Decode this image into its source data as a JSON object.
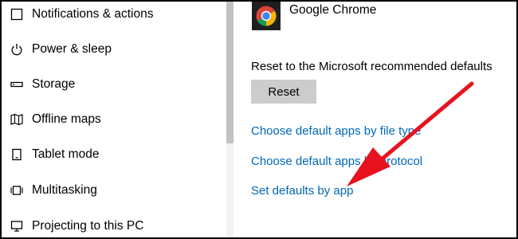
{
  "sidebar": {
    "items": [
      {
        "label": "Notifications & actions",
        "icon": "notifications-icon"
      },
      {
        "label": "Power & sleep",
        "icon": "power-icon"
      },
      {
        "label": "Storage",
        "icon": "storage-icon"
      },
      {
        "label": "Offline maps",
        "icon": "map-icon"
      },
      {
        "label": "Tablet mode",
        "icon": "tablet-icon"
      },
      {
        "label": "Multitasking",
        "icon": "multitasking-icon"
      },
      {
        "label": "Projecting to this PC",
        "icon": "projecting-icon"
      }
    ]
  },
  "main": {
    "default_app": {
      "name": "Google Chrome",
      "icon": "chrome-icon"
    },
    "reset": {
      "label": "Reset to the Microsoft recommended defaults",
      "button_label": "Reset"
    },
    "links": {
      "by_file_type": "Choose default apps by file type",
      "by_protocol": "Choose default apps by protocol",
      "by_app": "Set defaults by app"
    }
  },
  "annotation": {
    "arrow_color": "#e8121f"
  },
  "colors": {
    "link": "#0067b8",
    "button": "#cccccc",
    "scrollbar_thumb": "#c2c2c2"
  }
}
